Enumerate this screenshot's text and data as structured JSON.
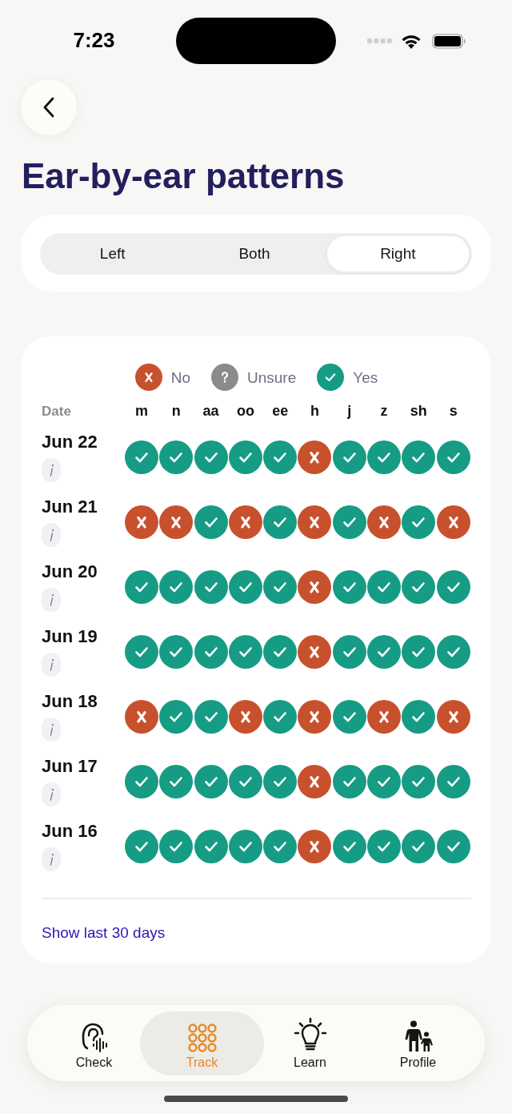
{
  "status_bar": {
    "time": "7:23"
  },
  "title": "Ear-by-ear patterns",
  "ear_selector": [
    {
      "label": "Left",
      "selected": false
    },
    {
      "label": "Both",
      "selected": false
    },
    {
      "label": "Right",
      "selected": true
    }
  ],
  "legend": [
    {
      "kind": "no",
      "label": "No"
    },
    {
      "kind": "unsure",
      "label": "Unsure"
    },
    {
      "kind": "yes",
      "label": "Yes"
    }
  ],
  "table": {
    "date_heading": "Date",
    "columns": [
      "m",
      "n",
      "aa",
      "oo",
      "ee",
      "h",
      "j",
      "z",
      "sh",
      "s"
    ],
    "rows": [
      {
        "date": "Jun 22",
        "results": [
          {
            "kind": "yes"
          },
          {
            "kind": "yes"
          },
          {
            "kind": "yes"
          },
          {
            "kind": "yes"
          },
          {
            "kind": "yes"
          },
          {
            "kind": "no"
          },
          {
            "kind": "yes"
          },
          {
            "kind": "yes"
          },
          {
            "kind": "yes"
          },
          {
            "kind": "yes"
          }
        ]
      },
      {
        "date": "Jun 21",
        "results": [
          {
            "kind": "no"
          },
          {
            "kind": "no"
          },
          {
            "kind": "yes"
          },
          {
            "kind": "no"
          },
          {
            "kind": "yes"
          },
          {
            "kind": "no"
          },
          {
            "kind": "yes"
          },
          {
            "kind": "no"
          },
          {
            "kind": "yes"
          },
          {
            "kind": "no"
          }
        ]
      },
      {
        "date": "Jun 20",
        "results": [
          {
            "kind": "yes"
          },
          {
            "kind": "yes"
          },
          {
            "kind": "yes"
          },
          {
            "kind": "yes"
          },
          {
            "kind": "yes"
          },
          {
            "kind": "no"
          },
          {
            "kind": "yes"
          },
          {
            "kind": "yes"
          },
          {
            "kind": "yes"
          },
          {
            "kind": "yes"
          }
        ]
      },
      {
        "date": "Jun 19",
        "results": [
          {
            "kind": "yes"
          },
          {
            "kind": "yes"
          },
          {
            "kind": "yes"
          },
          {
            "kind": "yes"
          },
          {
            "kind": "yes"
          },
          {
            "kind": "no"
          },
          {
            "kind": "yes"
          },
          {
            "kind": "yes"
          },
          {
            "kind": "yes"
          },
          {
            "kind": "yes"
          }
        ]
      },
      {
        "date": "Jun 18",
        "results": [
          {
            "kind": "no"
          },
          {
            "kind": "yes"
          },
          {
            "kind": "yes"
          },
          {
            "kind": "no"
          },
          {
            "kind": "yes"
          },
          {
            "kind": "no"
          },
          {
            "kind": "yes"
          },
          {
            "kind": "no"
          },
          {
            "kind": "yes"
          },
          {
            "kind": "no"
          }
        ]
      },
      {
        "date": "Jun 17",
        "results": [
          {
            "kind": "yes"
          },
          {
            "kind": "yes"
          },
          {
            "kind": "yes"
          },
          {
            "kind": "yes"
          },
          {
            "kind": "yes"
          },
          {
            "kind": "no"
          },
          {
            "kind": "yes"
          },
          {
            "kind": "yes"
          },
          {
            "kind": "yes"
          },
          {
            "kind": "yes"
          }
        ]
      },
      {
        "date": "Jun 16",
        "results": [
          {
            "kind": "yes"
          },
          {
            "kind": "yes"
          },
          {
            "kind": "yes"
          },
          {
            "kind": "yes"
          },
          {
            "kind": "yes"
          },
          {
            "kind": "no"
          },
          {
            "kind": "yes"
          },
          {
            "kind": "yes"
          },
          {
            "kind": "yes"
          },
          {
            "kind": "yes"
          }
        ]
      }
    ]
  },
  "show_more_link": "Show last 30 days",
  "tab_bar": [
    {
      "label": "Check",
      "selected": false
    },
    {
      "label": "Track",
      "selected": true
    },
    {
      "label": "Learn",
      "selected": false
    },
    {
      "label": "Profile",
      "selected": false
    }
  ]
}
